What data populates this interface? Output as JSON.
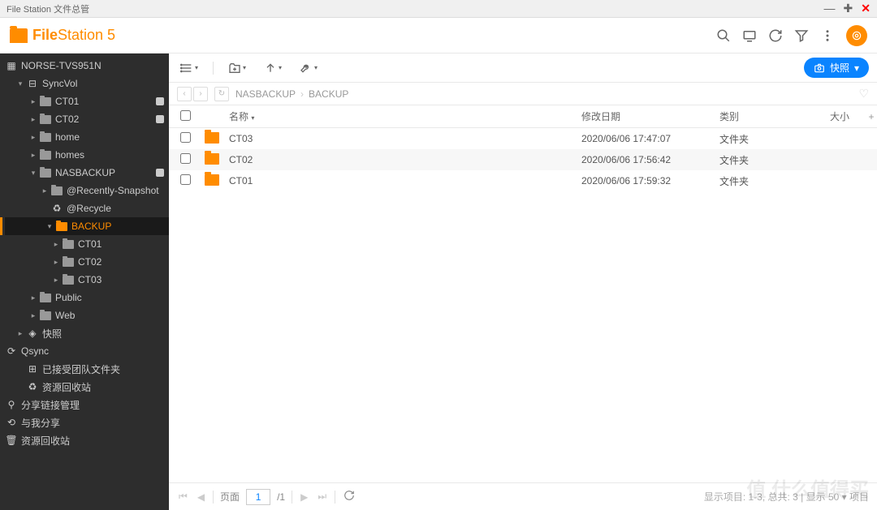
{
  "window": {
    "title": "File Station 文件总管"
  },
  "app": {
    "name_bold": "File",
    "name_light": "Station 5"
  },
  "snapshot_btn": "快照",
  "sidebar": {
    "root": "NORSE-TVS951N",
    "syncvol": "SyncVol",
    "items": {
      "ct01": "CT01",
      "ct02": "CT02",
      "home": "home",
      "homes": "homes",
      "nasbackup": "NASBACKUP",
      "recent_snap": "@Recently-Snapshot",
      "recycle": "@Recycle",
      "backup": "BACKUP",
      "b_ct01": "CT01",
      "b_ct02": "CT02",
      "b_ct03": "CT03",
      "public": "Public",
      "web": "Web",
      "kuaizhao": "快照"
    },
    "qsync": "Qsync",
    "qsync_items": {
      "accepted": "已接受团队文件夹",
      "recycle": "资源回收站"
    },
    "share_mgmt": "分享链接管理",
    "share_with_me": "与我分享",
    "trash": "资源回收站"
  },
  "breadcrumb": {
    "seg1": "NASBACKUP",
    "seg2": "BACKUP"
  },
  "columns": {
    "name": "名称",
    "date": "修改日期",
    "type": "类别",
    "size": "大小"
  },
  "rows": [
    {
      "name": "CT03",
      "date": "2020/06/06 17:47:07",
      "type": "文件夹"
    },
    {
      "name": "CT02",
      "date": "2020/06/06 17:56:42",
      "type": "文件夹"
    },
    {
      "name": "CT01",
      "date": "2020/06/06 17:59:32",
      "type": "文件夹"
    }
  ],
  "pagination": {
    "page_label": "页面",
    "page": "1",
    "total": "/1",
    "status": "显示项目: 1-3, 总共: 3 | 显示 50 ▾ 项目"
  },
  "watermark": "值 什么值得买"
}
